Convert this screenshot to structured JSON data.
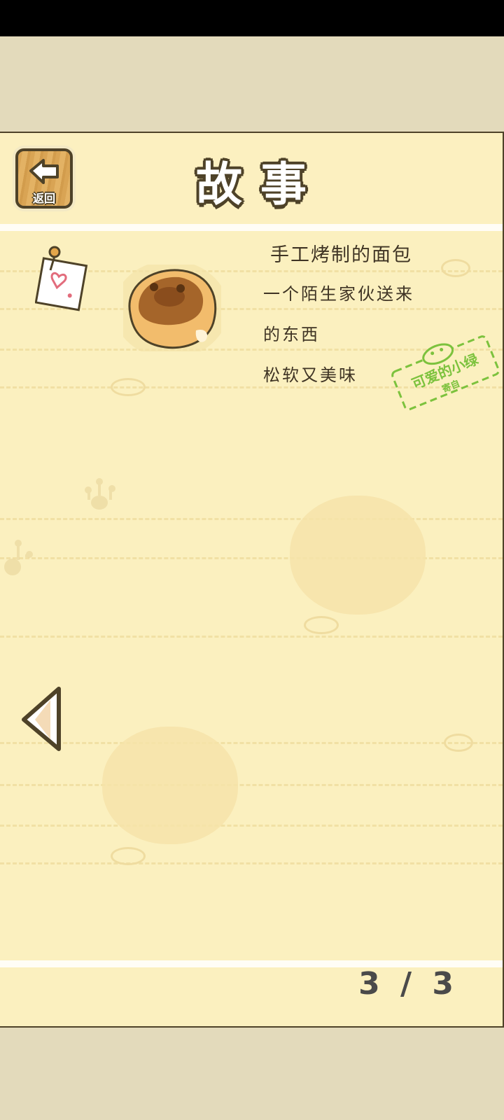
{
  "header": {
    "back_label": "返回",
    "title": "故事"
  },
  "story": {
    "title": "手工烤制的面包",
    "lines": [
      "一个陌生家伙送来",
      "的东西",
      "松软又美味"
    ]
  },
  "stamp": {
    "main": "可爱的小绿",
    "sub": "寄自"
  },
  "pagination": {
    "text": "3 / 3"
  },
  "colors": {
    "panel_bg": "#fbf0bf",
    "outline": "#4e4228",
    "stamp_green": "#7cc23d",
    "page_bg": "#e3dabb"
  },
  "icons": {
    "back": "arrow-left-icon",
    "note": "heart-note-icon",
    "item": "bread-icon",
    "prev": "triangle-left-icon"
  }
}
